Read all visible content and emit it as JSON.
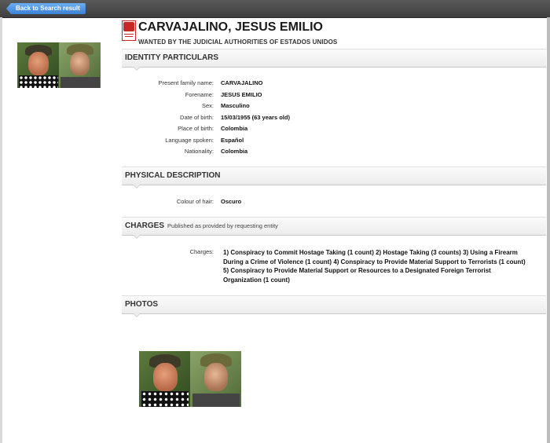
{
  "toolbar": {
    "back_label": "Back to Search result"
  },
  "header": {
    "name": "CARVAJALINO, JESUS EMILIO",
    "subtitle": "WANTED BY THE JUDICIAL AUTHORITIES OF ESTADOS UNIDOS"
  },
  "sections": {
    "identity": "IDENTITY PARTICULARS",
    "physical": "PHYSICAL DESCRIPTION",
    "charges": "CHARGES",
    "charges_sub": "Published as provided by requesting entity",
    "photos": "PHOTOS"
  },
  "identity": [
    {
      "label": "Present family name:",
      "value": "CARVAJALINO"
    },
    {
      "label": "Forename:",
      "value": "JESUS EMILIO"
    },
    {
      "label": "Sex:",
      "value": "Masculino"
    },
    {
      "label": "Date of birth:",
      "value": "15/03/1955 (63 years old)"
    },
    {
      "label": "Place of birth:",
      "value": "Colombia"
    },
    {
      "label": "Language spoken:",
      "value": "Español"
    },
    {
      "label": "Nationality:",
      "value": "Colombia"
    }
  ],
  "physical": [
    {
      "label": "Colour of hair:",
      "value": "Oscuro"
    }
  ],
  "charges": {
    "label": "Charges:",
    "value": "1) Conspiracy to Commit Hostage Taking (1 count) 2) Hostage Taking (3 counts) 3) Using a Firearm During a Crime of Violence (1 count) 4) Conspiracy to Provide Material Support to Terrorists (1 count) 5) Conspiracy to Provide Material Support or Resources to a Designated Foreign Terrorist Organization (1 count)"
  },
  "colors": {
    "accent_blue": "#3b82d6",
    "emblem_red": "#c62828"
  }
}
